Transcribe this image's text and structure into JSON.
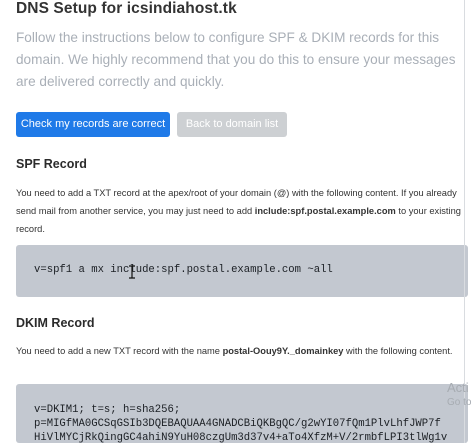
{
  "header": {
    "title": "DNS Setup for icsindiahost.tk"
  },
  "intro": {
    "text": "Follow the instructions below to configure SPF & DKIM records for this domain. We highly recommend that you do this to ensure your messages are delivered correctly and quickly."
  },
  "actions": {
    "check_label": "Check my records are correct",
    "back_label": "Back to domain list"
  },
  "spf": {
    "title": "SPF Record",
    "text_before": "You need to add a TXT record at the apex/root of your domain (@) with the following content. If you already send mail from another service, you may just need to add ",
    "include_value": "include:spf.postal.example.com",
    "text_after": " to your existing record.",
    "record": "v=spf1 a mx include:spf.postal.example.com ~all"
  },
  "dkim": {
    "title": "DKIM Record",
    "text_before": "You need to add a new TXT record with the name ",
    "record_name": "postal-Oouy9Y._domainkey",
    "text_after": " with the following content.",
    "record_lines": [
      "v=DKIM1; t=s; h=sha256;",
      "p=MIGfMA0GCSqGSIb3DQEBAQUAA4GNADCBiQKBgQC/g2wYI07fQm1PlvLhfJWP7f",
      "HiVlMYCjRkQingGC4ahiN9YuH08czgUm3d37v4+aTo4XfzM+V/2rmbfLPI3tlWg1v"
    ]
  },
  "watermark": {
    "line1": "Acti",
    "line2": "Go to"
  }
}
